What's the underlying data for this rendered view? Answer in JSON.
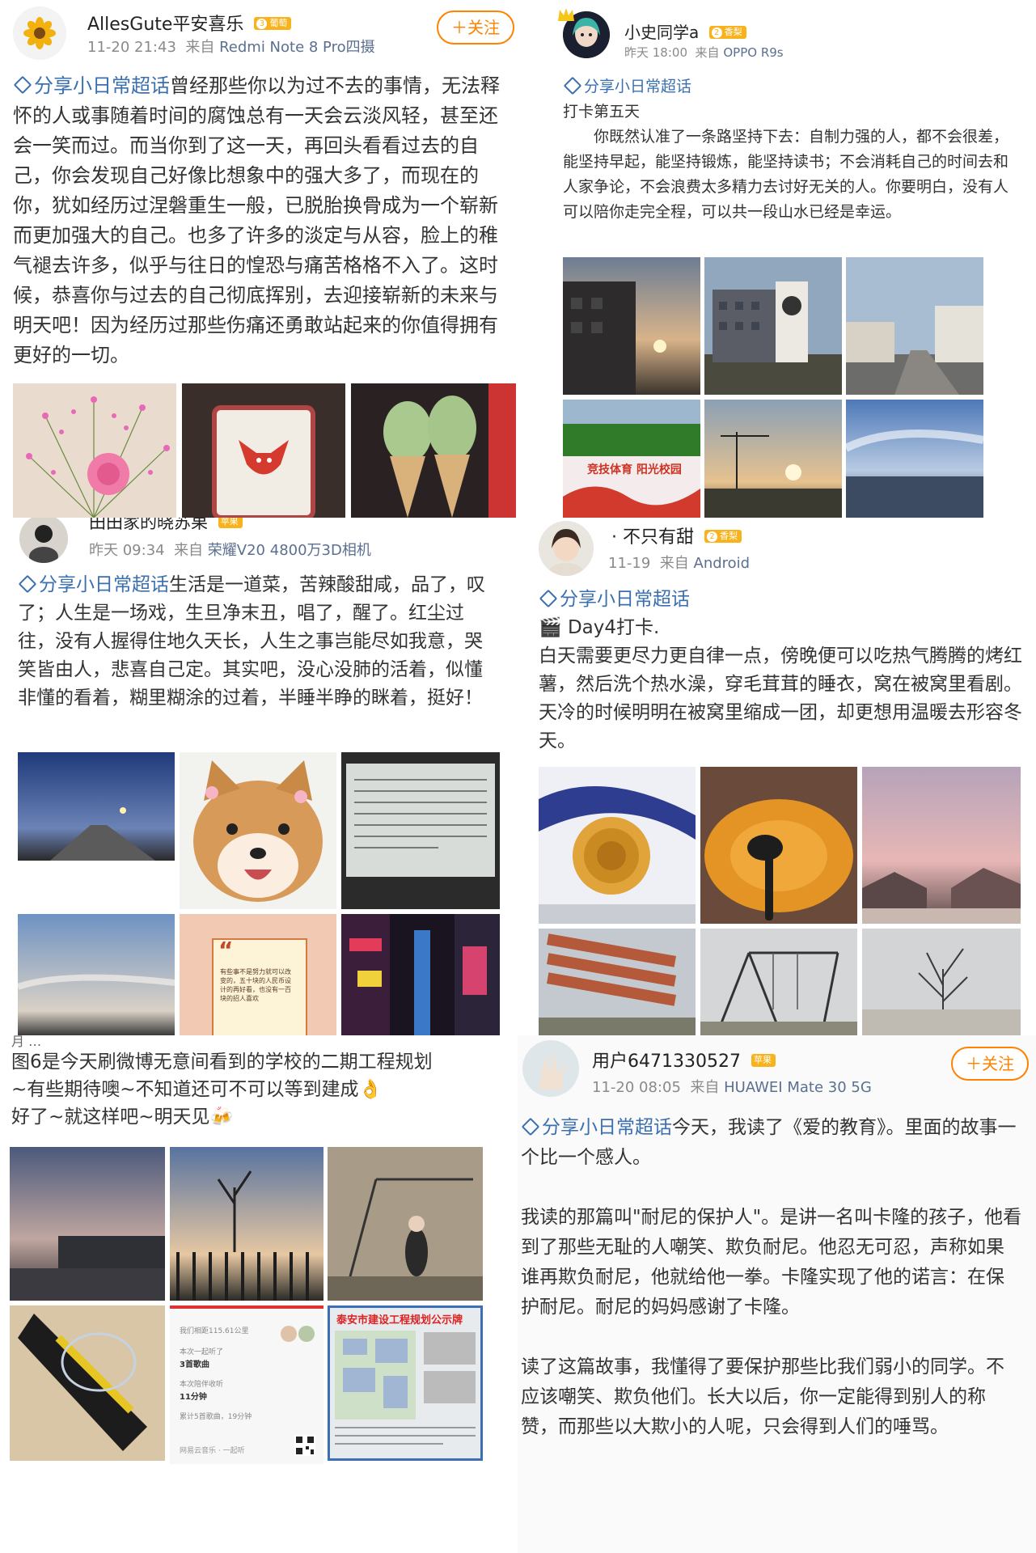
{
  "posts": [
    {
      "user": "AllesGute平安喜乐",
      "badge_level": "3",
      "badge_text": "葡萄",
      "time": "11-20 21:43",
      "source_prefix": "来自",
      "device": "Redmi Note 8 Pro四摄",
      "follow_label": "＋关注",
      "topic": "分享小日常超话",
      "body": "曾经那些你以为过不去的事情，无法释怀的人或事随着时间的腐蚀总有一天会云淡风轻，甚至还会一笑而过。而当你到了这一天，再回头看看过去的自己，你会发现自己好像比想象中的强大多了，而现在的你，犹如经历过涅磐重生一般，已脱胎换骨成为一个崭新而更加强大的自己。也多了许多的淡定与从容，脸上的稚气褪去许多，似乎与往日的惶恐与痛苦格格不入了。这时候，恭喜你与过去的自己彻底挥别，去迎接崭新的未来与明天吧！因为经历过那些伤痛还勇敢站起来的你值得拥有更好的一切。",
      "photos": [
        "flowers-photo",
        "fox-paper-cut-photo",
        "matcha-icecream-photo"
      ]
    },
    {
      "user": "小史同学a",
      "badge_level": "2",
      "badge_text": "香梨",
      "time": "昨天 18:00",
      "source_prefix": "来自",
      "device": "OPPO R9s",
      "topic": "分享小日常超话",
      "line1": "打卡第五天",
      "body": "你既然认准了一条路坚持下去：自制力强的人，都不会很差，能坚持早起，能坚持锻炼，能坚持读书；不会消耗自己的时间去和人家争论，不会浪费太多精力去讨好无关的人。你要明白，没有人可以陪你走完全程，可以共一段山水已经是幸运。",
      "photos": [
        "campus-building-sunset-photo",
        "campus-building-photo",
        "campus-road-photo",
        "sports-field-photo",
        "construction-sunset-photo",
        "lake-sky-photo"
      ]
    },
    {
      "user": "田田家的晓苏果",
      "badge_text": "苹果",
      "time": "昨天 09:34",
      "source_prefix": "来自",
      "device": "荣耀V20 4800万3D相机",
      "topic": "分享小日常超话",
      "body": "生活是一道菜，苦辣酸甜咸，品了，叹了；人生是一场戏，生旦净末丑，唱了，醒了。红尘过往，没有人握得住地久天长，人生之事岂能尽如我意，哭笑皆由人，悲喜自己定。其实吧，没心没肺的活着，似懂非懂的看着，糊里糊涂的过着，半睡半睁的眯着，挺好！",
      "photos": [
        "night-street-photo",
        "shiba-dog-photo",
        "lecture-screen-photo",
        "evening-sky-photo",
        "quote-card-photo",
        "neon-street-photo"
      ]
    },
    {
      "user": "· 不只有甜",
      "badge_level": "2",
      "badge_text": "香梨",
      "time": "11-19",
      "source_prefix": "来自",
      "device": "Android",
      "topic": "分享小日常超话",
      "line1": "🎬 Day4打卡.",
      "body": "白天需要更尽力更自律一点，傍晚便可以吃热气腾腾的烤红薯，然后洗个热水澡，穿毛茸茸的睡衣，窝在被窝里看剧。天冷的时候明明在被窝里缩成一团，却更想用温暖去形容冬天。",
      "photos": [
        "flower-cake-photo",
        "roasted-sweet-potato-photo",
        "pink-sky-photo",
        "park-bench-photo",
        "swing-set-photo",
        "bare-tree-photo"
      ]
    },
    {
      "cut_name": "月 …",
      "line1": "图6是今天刷微博无意间看到的学校的二期工程规划",
      "line2": "~有些期待噢~不知道还可不可以等到建成👌",
      "line3": "好了~就这样吧~明天见🍻",
      "photos": [
        "dusk-street-photo",
        "sunset-fence-photo",
        "swing-girl-photo",
        "badminton-racket-photo",
        "music-stats-screenshot",
        "construction-plan-board-photo"
      ],
      "music_card": {
        "line1": "我们相距115.61公里",
        "line2": "本次一起听了",
        "line3": "3首歌曲",
        "line4": "本次陪伴收听",
        "line5": "11分钟",
        "line6": "累计5首歌曲，19分钟",
        "footer": "网易云音乐 · 一起听"
      },
      "plan_board_title": "泰安市建设工程规划公示牌"
    },
    {
      "user": "用户6471330527",
      "badge_text": "苹果",
      "time": "11-20 08:05",
      "source_prefix": "来自",
      "device": "HUAWEI Mate 30 5G",
      "follow_label": "＋关注",
      "topic": "分享小日常超话",
      "intro": "今天，我读了《爱的教育》。里面的故事一个比一个感人。",
      "para2": "我读的那篇叫\"耐尼的保护人\"。是讲一名叫卡隆的孩子，他看到了那些无耻的人嘲笑、欺负耐尼。他忍无可忍，声称如果谁再欺负耐尼，他就给他一拳。卡隆实现了他的诺言：在保护耐尼。耐尼的妈妈感谢了卡隆。",
      "para3": "读了这篇故事，我懂得了要保护那些比我们弱小的同学。不应该嘲笑、欺负他们。长大以后，你一定能得到别人的称赞，而那些以大欺小的人呢，只会得到人们的唾骂。"
    }
  ],
  "photo_texts": {
    "sports_banner": "竞技体育 阳光校园",
    "quote_card": "有些事不是努力就可以改变的，五十块的人民币设计的再好看，也没有一百块的招人喜欢"
  },
  "colors": {
    "topic_blue": "#3a6fb0",
    "follow_orange": "#ff8200",
    "badge_gold": "#f7b21c"
  }
}
